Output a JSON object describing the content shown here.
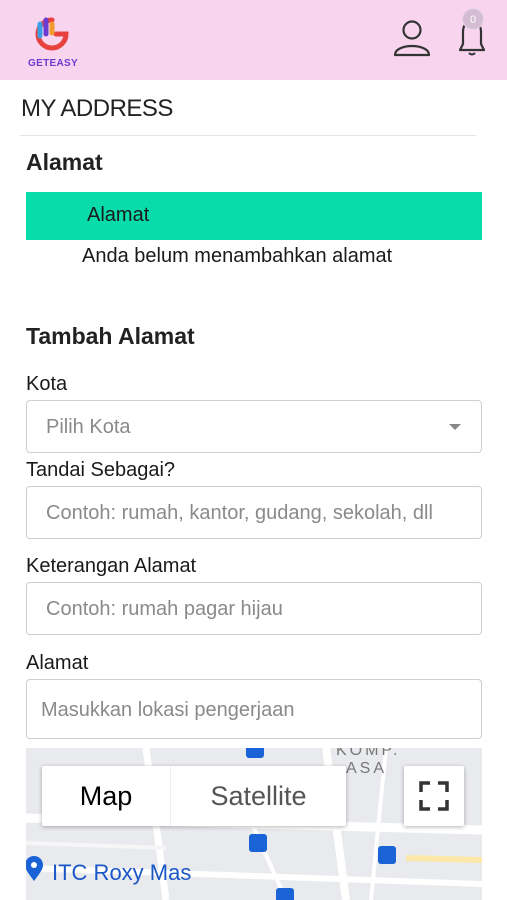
{
  "header": {
    "logo_text": "GETEASY",
    "notification_count": "0"
  },
  "page": {
    "title": "MY ADDRESS"
  },
  "address_section": {
    "heading": "Alamat",
    "bar_label": "Alamat",
    "empty_message": "Anda belum menambahkan alamat"
  },
  "add_section": {
    "heading": "Tambah Alamat",
    "city_label": "Kota",
    "city_placeholder": "Pilih Kota",
    "tag_label": "Tandai Sebagai?",
    "tag_placeholder": "Contoh: rumah, kantor, gudang, sekolah, dll",
    "desc_label": "Keterangan Alamat",
    "desc_placeholder": "Contoh: rumah pagar hijau",
    "address_label": "Alamat",
    "address_placeholder": "Masukkan lokasi pengerjaan"
  },
  "map": {
    "map_button": "Map",
    "satellite_button": "Satellite",
    "place_label": "ITC Roxy Mas",
    "area_label_1": "KOMP.",
    "area_label_2": "ASA"
  },
  "colors": {
    "header_bg": "#f8d4ef",
    "accent_green": "#08dcab",
    "logo_purple": "#6c3bd1"
  },
  "icons": {
    "logo": "geteasy-logo",
    "user": "user-icon",
    "bell": "bell-icon",
    "dropdown": "chevron-down-icon",
    "fullscreen": "fullscreen-icon"
  }
}
